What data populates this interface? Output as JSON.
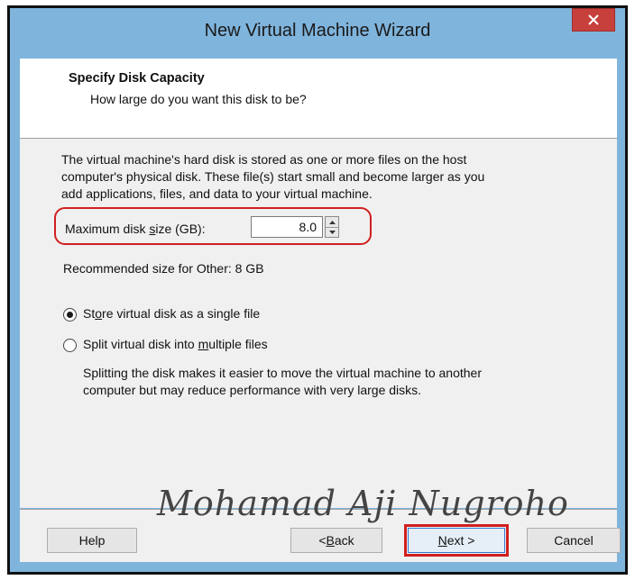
{
  "window": {
    "title": "New Virtual Machine Wizard",
    "close_icon": "close-icon"
  },
  "header": {
    "title": "Specify Disk Capacity",
    "subtitle": "How large do you want this disk to be?"
  },
  "content": {
    "description_lines": [
      "The virtual machine's hard disk is stored as one or more files on the host",
      "computer's physical disk. These file(s) start small and become larger as you",
      "add applications, files, and data to your virtual machine."
    ],
    "max_disk_size_label_pre": "Maximum disk ",
    "max_disk_size_label_accel": "s",
    "max_disk_size_label_post": "ize (GB):",
    "max_disk_size_value": "8.0",
    "recommended": "Recommended size for Other: 8 GB",
    "option_single": {
      "label_pre": "St",
      "label_accel": "o",
      "label_post": "re virtual disk as a single file",
      "selected": true
    },
    "option_split": {
      "label_pre": "Split virtual disk into ",
      "label_accel": "m",
      "label_post": "ultiple files",
      "selected": false
    },
    "split_note_lines": [
      "Splitting the disk makes it easier to move the virtual machine to another",
      "computer but may reduce performance with very large disks."
    ]
  },
  "watermark": "Mohamad Aji Nugroho",
  "footer": {
    "help_label": "Help",
    "back_pre": "< ",
    "back_accel": "B",
    "back_post": "ack",
    "next_accel": "N",
    "next_post": "ext >",
    "cancel_label": "Cancel"
  },
  "colors": {
    "title_bar": "#7fb4dc",
    "close_button": "#c7403c",
    "highlight": "#d01f1f",
    "panel": "#f0f0f0"
  }
}
